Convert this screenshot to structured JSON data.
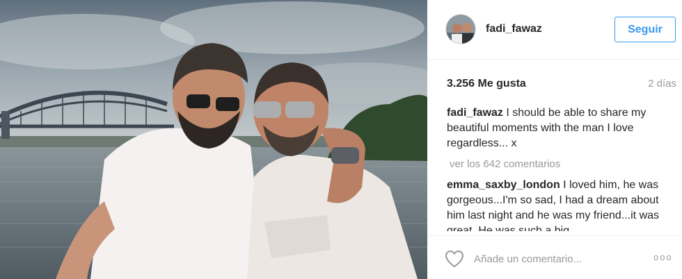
{
  "post": {
    "author": "fadi_fawaz",
    "follow_label": "Seguir",
    "likes": "3.256 Me gusta",
    "time_ago": "2 días",
    "caption_user": "fadi_fawaz",
    "caption_text": " I should be able to share my beautiful moments with the man I love regardless... x",
    "view_comments": "ver los 642 comentarios",
    "comments": [
      {
        "user": "emma_saxby_london",
        "text": " I loved him, he was gorgeous...I'm so sad, I had a dream about him last night and he was my friend...it was great. He was such a big"
      }
    ],
    "add_comment_placeholder": "Añade un comentario...",
    "more_glyph": "ooo"
  },
  "icons": {
    "like": "heart-outline-icon",
    "more": "more-options-icon"
  },
  "colors": {
    "accent": "#3897f0",
    "text": "#262626",
    "muted": "#999999",
    "divider": "#efefef"
  }
}
